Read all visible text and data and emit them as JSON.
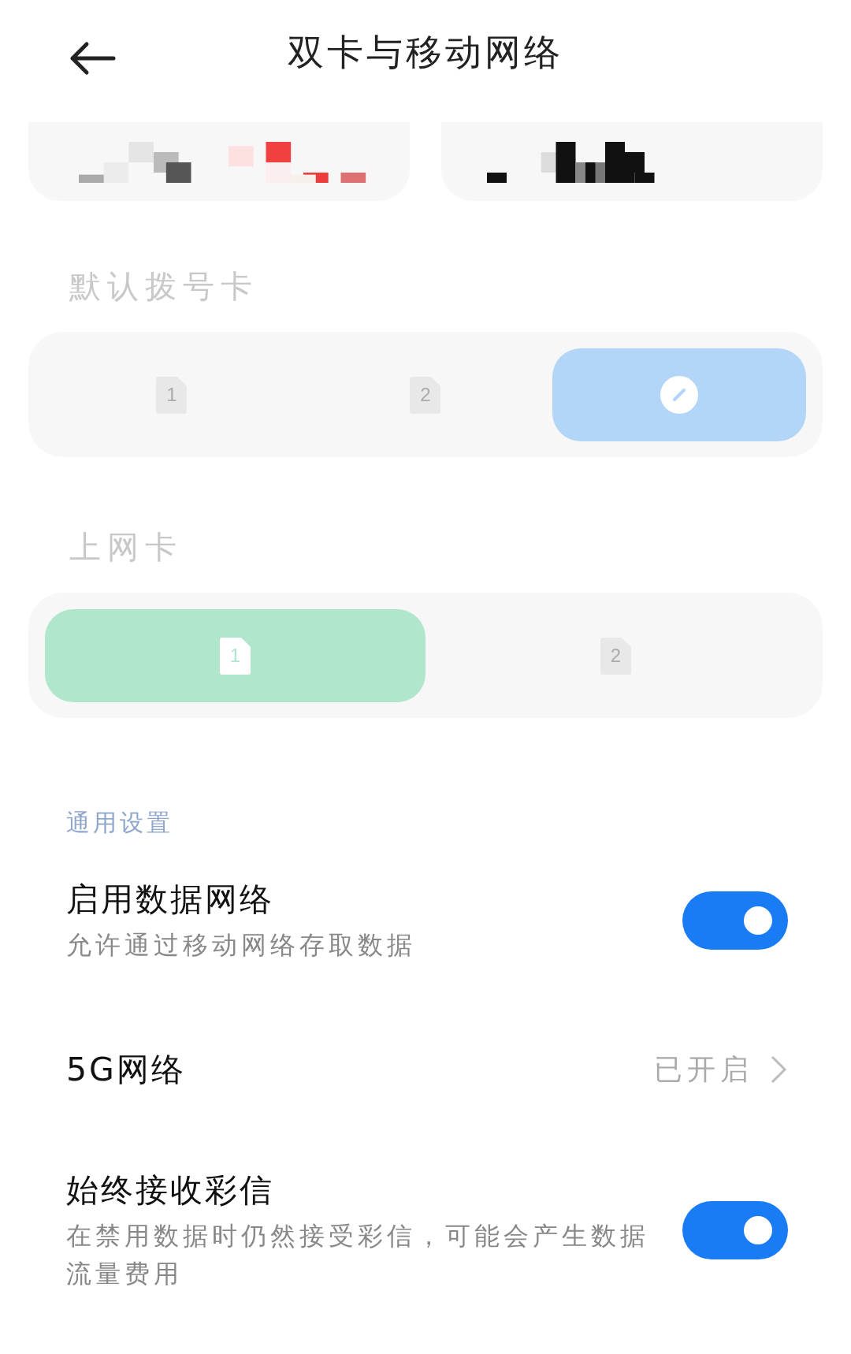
{
  "header": {
    "title": "双卡与移动网络"
  },
  "sim_summary": [
    {
      "kind": "pixelated"
    },
    {
      "kind": "pixelated"
    }
  ],
  "default_call_card": {
    "label": "默认拨号卡",
    "options": [
      {
        "kind": "sim",
        "number": "1",
        "selected": false
      },
      {
        "kind": "sim",
        "number": "2",
        "selected": false
      },
      {
        "kind": "ask",
        "selected": true
      }
    ]
  },
  "data_card": {
    "label": "上网卡",
    "options": [
      {
        "kind": "sim",
        "number": "1",
        "selected": true
      },
      {
        "kind": "sim",
        "number": "2",
        "selected": false
      }
    ]
  },
  "general_settings": {
    "heading": "通用设置",
    "rows": [
      {
        "kind": "toggle",
        "title": "启用数据网络",
        "subtitle": "允许通过移动网络存取数据",
        "on": true
      },
      {
        "kind": "link",
        "title": "5G网络",
        "value": "已开启"
      },
      {
        "kind": "toggle",
        "title": "始终接收彩信",
        "subtitle": "在禁用数据时仍然接受彩信，可能会产生数据流量费用",
        "on": true
      }
    ]
  }
}
